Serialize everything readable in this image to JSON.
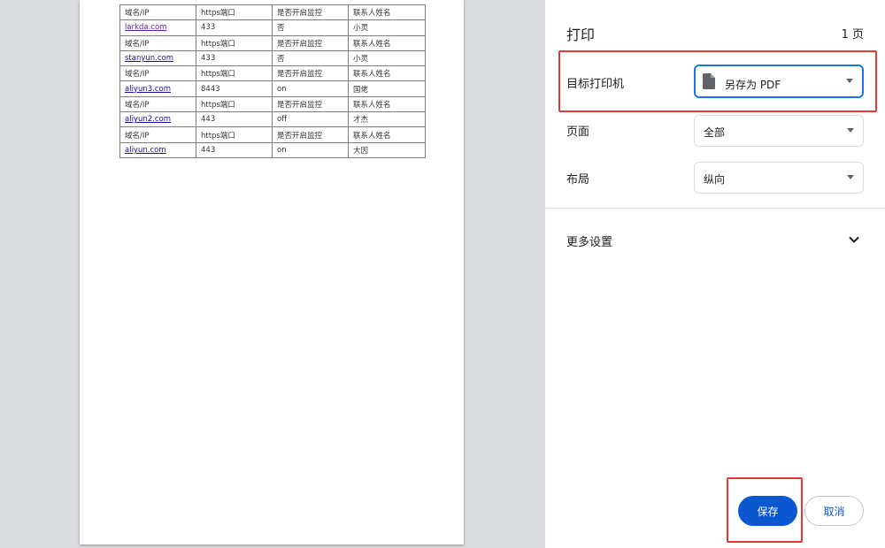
{
  "preview": {
    "table": {
      "header": [
        "域名/IP",
        "https端口",
        "是否开启监控",
        "联系人姓名"
      ],
      "rows": [
        {
          "domain": "larkda.com",
          "port": "433",
          "monitor": "否",
          "contact": "小灵"
        },
        {
          "domain": "stanyun.com",
          "port": "433",
          "monitor": "否",
          "contact": "小灵"
        },
        {
          "domain": "aliyun3.com",
          "port": "8443",
          "monitor": "on",
          "contact": "国佬"
        },
        {
          "domain": "aliyun2.com",
          "port": "443",
          "monitor": "off",
          "contact": "才杰"
        },
        {
          "domain": "aliyun.com",
          "port": "443",
          "monitor": "on",
          "contact": "大因"
        }
      ]
    }
  },
  "settings": {
    "title": "打印",
    "page_count": "1 页",
    "printer": {
      "label": "目标打印机",
      "value": "另存为 PDF",
      "icon": "file-icon"
    },
    "pages": {
      "label": "页面",
      "value": "全部"
    },
    "layout": {
      "label": "布局",
      "value": "纵向"
    },
    "more_settings": {
      "label": "更多设置",
      "icon": "chevron-down-icon"
    },
    "save_label": "保存",
    "cancel_label": "取消"
  },
  "colors": {
    "accent": "#0b57d0",
    "focus": "#1a73e8",
    "annotation": "#e53935"
  }
}
